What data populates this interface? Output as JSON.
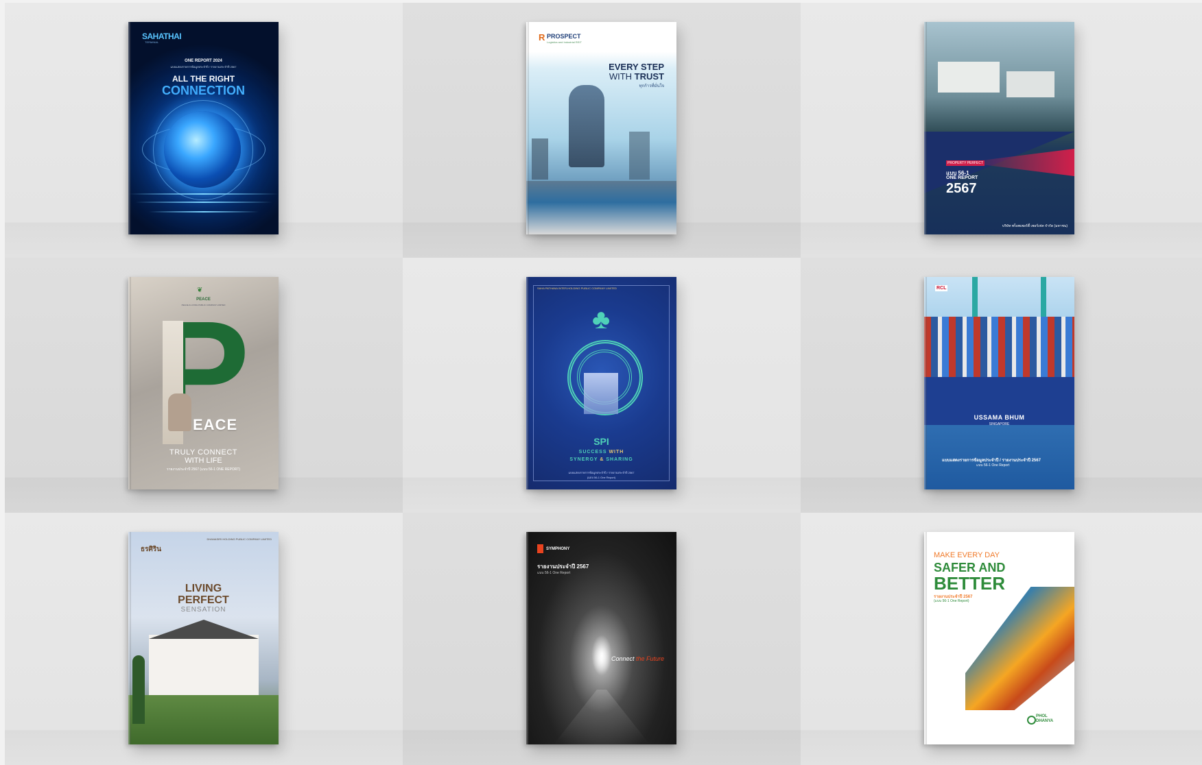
{
  "books": [
    {
      "brand": "SAHATHAI",
      "brand_sub": "TERMINAL",
      "report": "ONE REPORT 2024",
      "thai_sub": "แบบแสดงรายการข้อมูลประจำปี / รายงานประจำปี 2567",
      "headline1": "ALL THE RIGHT",
      "headline2": "CONNECTION"
    },
    {
      "brand": "PROSPECT",
      "brand_sub": "Logistics and Industrial REIT",
      "headline1": "EVERY STEP",
      "headline2a": "WITH ",
      "headline2b": "TRUST",
      "thai_sub": "ทุกก้าวที่มั่นใจ"
    },
    {
      "brand_tag": "PROPERTY PERFECT",
      "line1": "แบบ 56-1",
      "line2": "ONE REPORT",
      "year": "2567",
      "footer": "บริษัท พร็อพเพอร์ตี้ เพอร์เฟค จำกัด (มหาชน)"
    },
    {
      "brand": "PEACE",
      "brand_sub": "PEACE & LIVING PUBLIC COMPANY LIMITED",
      "big_letter": "P",
      "word": "EACE",
      "tagline1": "TRULY CONNECT",
      "tagline2": "WITH LIFE",
      "report": "รายงานประจำปี 2567 (แบบ 56-1 ONE REPORT)"
    },
    {
      "brand_line": "SAHA PATHANA INTER-HOLDING PUBLIC COMPANY LIMITED",
      "abbr": "SPI",
      "tag1a": "SUCCESS ",
      "tag1b": "WITH",
      "tag2a": "SYNERGY ",
      "tag2b": "& ",
      "tag2c": "SHARING",
      "report": "แบบแสดงรายการข้อมูลประจำปี / รายงานประจำปี 2567",
      "report2": "(แบบ 56-1 One Report)"
    },
    {
      "logo": "RCL",
      "ship_name": "USSAMA BHUM",
      "ship_port": "SINGAPORE",
      "report": "แบบแสดงรายการข้อมูลประจำปี / รายงานประจำปี 2567",
      "report2": "แบบ 56-1 One Report"
    },
    {
      "logo": "ธรศิริน",
      "company": "DHANASIRI HOLDING PUBLIC COMPANY LIMITED",
      "line1": "LIVING",
      "line2": "PERFECT",
      "line3": "SENSATION"
    },
    {
      "brand": "SYMPHONY",
      "report": "รายงานประจำปี 2567",
      "report2": "แบบ 56-1 One Report",
      "tagline_a": "Connect ",
      "tagline_b": "the Future"
    },
    {
      "headline1": "MAKE EVERY DAY",
      "headline2": "SAFER AND",
      "headline3": "BETTER",
      "report": "รายงานประจำปี 2567",
      "report2": "(แบบ 56-1 One Report)",
      "logo1": "PHOL",
      "logo2": "DHANYA"
    }
  ],
  "colors": {
    "wall": "#e4e4e4",
    "wall_alt": "#d9d9d9",
    "peace_green": "#1e6b35",
    "phol_green": "#2e8b3a",
    "phol_orange": "#f07a2a"
  }
}
